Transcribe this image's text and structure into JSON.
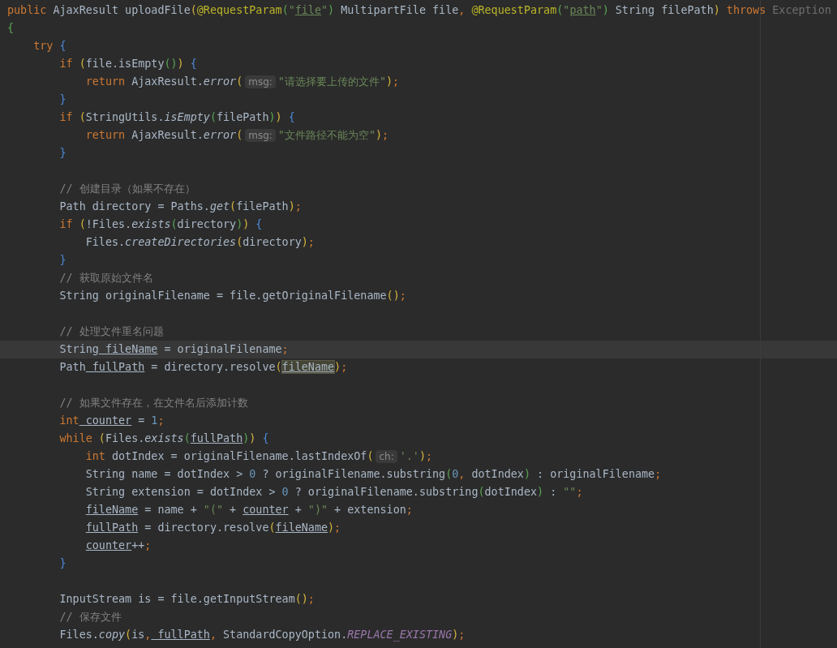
{
  "editor": {
    "lines": [
      {
        "kind": "code",
        "current": false,
        "tokens": [
          {
            "kind": "kw",
            "text": "public"
          },
          {
            "kind": "text",
            "text": " AjaxResult uploadFile"
          },
          {
            "kind": "br1",
            "text": "("
          },
          {
            "kind": "ann",
            "text": "@RequestParam"
          },
          {
            "kind": "br2",
            "text": "("
          },
          {
            "kind": "str",
            "text": "\""
          },
          {
            "kind": "strvar",
            "text": "file"
          },
          {
            "kind": "str",
            "text": "\""
          },
          {
            "kind": "br2",
            "text": ")"
          },
          {
            "kind": "text",
            "text": " MultipartFile file"
          },
          {
            "kind": "punct",
            "text": ","
          },
          {
            "kind": "ann",
            "text": " @RequestParam"
          },
          {
            "kind": "br2",
            "text": "("
          },
          {
            "kind": "str",
            "text": "\""
          },
          {
            "kind": "strvar",
            "text": "path"
          },
          {
            "kind": "str",
            "text": "\""
          },
          {
            "kind": "br2",
            "text": ")"
          },
          {
            "kind": "text",
            "text": " String filePath"
          },
          {
            "kind": "br1",
            "text": ")"
          },
          {
            "kind": "kw",
            "text": " throws"
          },
          {
            "kind": "dim",
            "text": " Exception"
          }
        ]
      },
      {
        "kind": "code",
        "current": false,
        "tokens": [
          {
            "kind": "br2",
            "text": "{"
          }
        ],
        "children": [
          {
            "kind": "code",
            "current": false,
            "tokens": [
              {
                "kind": "kw",
                "text": "try"
              },
              {
                "kind": "br3",
                "text": " {"
              }
            ],
            "children": [
              {
                "kind": "code",
                "current": false,
                "tokens": [
                  {
                    "kind": "kw",
                    "text": "if"
                  },
                  {
                    "kind": "br1",
                    "text": " ("
                  },
                  {
                    "kind": "text",
                    "text": "file.isEmpty"
                  },
                  {
                    "kind": "br2",
                    "text": "()"
                  },
                  {
                    "kind": "br1",
                    "text": ")"
                  },
                  {
                    "kind": "br3",
                    "text": " {"
                  }
                ],
                "children": [
                  {
                    "kind": "code",
                    "current": false,
                    "tokens": [
                      {
                        "kind": "kw",
                        "text": "return"
                      },
                      {
                        "kind": "text",
                        "text": " AjaxResult."
                      },
                      {
                        "kind": "italic",
                        "text": "error"
                      },
                      {
                        "kind": "br1",
                        "text": "("
                      },
                      {
                        "kind": "hint",
                        "text": "msg:"
                      },
                      {
                        "kind": "str",
                        "text": "\"请选择要上传的文件\""
                      },
                      {
                        "kind": "br1",
                        "text": ")"
                      },
                      {
                        "kind": "punct",
                        "text": ";"
                      }
                    ]
                  }
                ]
              },
              {
                "kind": "code",
                "current": false,
                "tokens": [
                  {
                    "kind": "br3",
                    "text": "}"
                  }
                ]
              },
              {
                "kind": "code",
                "current": false,
                "tokens": [
                  {
                    "kind": "kw",
                    "text": "if"
                  },
                  {
                    "kind": "br1",
                    "text": " ("
                  },
                  {
                    "kind": "text",
                    "text": "StringUtils."
                  },
                  {
                    "kind": "italic",
                    "text": "isEmpty"
                  },
                  {
                    "kind": "br2",
                    "text": "("
                  },
                  {
                    "kind": "text",
                    "text": "filePath"
                  },
                  {
                    "kind": "br2",
                    "text": ")"
                  },
                  {
                    "kind": "br1",
                    "text": ")"
                  },
                  {
                    "kind": "br3",
                    "text": " {"
                  }
                ],
                "children": [
                  {
                    "kind": "code",
                    "current": false,
                    "tokens": [
                      {
                        "kind": "kw",
                        "text": "return"
                      },
                      {
                        "kind": "text",
                        "text": " AjaxResult."
                      },
                      {
                        "kind": "italic",
                        "text": "error"
                      },
                      {
                        "kind": "br1",
                        "text": "("
                      },
                      {
                        "kind": "hint",
                        "text": "msg:"
                      },
                      {
                        "kind": "str",
                        "text": "\"文件路径不能为空\""
                      },
                      {
                        "kind": "br1",
                        "text": ")"
                      },
                      {
                        "kind": "punct",
                        "text": ";"
                      }
                    ]
                  }
                ]
              },
              {
                "kind": "code",
                "current": false,
                "tokens": [
                  {
                    "kind": "br3",
                    "text": "}"
                  }
                ]
              },
              {
                "kind": "blank",
                "current": false
              },
              {
                "kind": "code",
                "current": false,
                "tokens": [
                  {
                    "kind": "comment",
                    "text": "// 创建目录（如果不存在）"
                  }
                ]
              },
              {
                "kind": "code",
                "current": false,
                "tokens": [
                  {
                    "kind": "text",
                    "text": "Path directory = Paths."
                  },
                  {
                    "kind": "italic",
                    "text": "get"
                  },
                  {
                    "kind": "br1",
                    "text": "("
                  },
                  {
                    "kind": "text",
                    "text": "filePath"
                  },
                  {
                    "kind": "br1",
                    "text": ")"
                  },
                  {
                    "kind": "punct",
                    "text": ";"
                  }
                ]
              },
              {
                "kind": "code",
                "current": false,
                "tokens": [
                  {
                    "kind": "kw",
                    "text": "if"
                  },
                  {
                    "kind": "br1",
                    "text": " ("
                  },
                  {
                    "kind": "text",
                    "text": "!Files."
                  },
                  {
                    "kind": "italic",
                    "text": "exists"
                  },
                  {
                    "kind": "br2",
                    "text": "("
                  },
                  {
                    "kind": "text",
                    "text": "directory"
                  },
                  {
                    "kind": "br2",
                    "text": ")"
                  },
                  {
                    "kind": "br1",
                    "text": ")"
                  },
                  {
                    "kind": "br3",
                    "text": " {"
                  }
                ],
                "children": [
                  {
                    "kind": "code",
                    "current": false,
                    "tokens": [
                      {
                        "kind": "text",
                        "text": "Files."
                      },
                      {
                        "kind": "italic",
                        "text": "createDirectories"
                      },
                      {
                        "kind": "br1",
                        "text": "("
                      },
                      {
                        "kind": "text",
                        "text": "directory"
                      },
                      {
                        "kind": "br1",
                        "text": ")"
                      },
                      {
                        "kind": "punct",
                        "text": ";"
                      }
                    ]
                  }
                ]
              },
              {
                "kind": "code",
                "current": false,
                "tokens": [
                  {
                    "kind": "br3",
                    "text": "}"
                  }
                ]
              },
              {
                "kind": "code",
                "current": false,
                "tokens": [
                  {
                    "kind": "comment",
                    "text": "// 获取原始文件名"
                  }
                ]
              },
              {
                "kind": "code",
                "current": false,
                "tokens": [
                  {
                    "kind": "text",
                    "text": "String originalFilename = file.getOriginalFilename"
                  },
                  {
                    "kind": "br1",
                    "text": "()"
                  },
                  {
                    "kind": "punct",
                    "text": ";"
                  }
                ]
              },
              {
                "kind": "blank",
                "current": false
              },
              {
                "kind": "code",
                "current": false,
                "tokens": [
                  {
                    "kind": "comment",
                    "text": "// 处理文件重名问题"
                  }
                ]
              },
              {
                "kind": "code",
                "current": true,
                "tokens": [
                  {
                    "kind": "text",
                    "text": "String"
                  },
                  {
                    "kind": "var",
                    "text": " fileName"
                  },
                  {
                    "kind": "text",
                    "text": " = originalFilename"
                  },
                  {
                    "kind": "punct",
                    "text": ";"
                  }
                ]
              },
              {
                "kind": "code",
                "current": false,
                "tokens": [
                  {
                    "kind": "text",
                    "text": "Path"
                  },
                  {
                    "kind": "var",
                    "text": " fullPath"
                  },
                  {
                    "kind": "text",
                    "text": " = directory.resolve"
                  },
                  {
                    "kind": "br1",
                    "text": "("
                  },
                  {
                    "kind": "hl",
                    "text": "fileName"
                  },
                  {
                    "kind": "br1",
                    "text": ")"
                  },
                  {
                    "kind": "punct",
                    "text": ";"
                  }
                ]
              },
              {
                "kind": "blank",
                "current": false
              },
              {
                "kind": "code",
                "current": false,
                "tokens": [
                  {
                    "kind": "comment",
                    "text": "// 如果文件存在，在文件名后添加计数"
                  }
                ]
              },
              {
                "kind": "code",
                "current": false,
                "tokens": [
                  {
                    "kind": "kw",
                    "text": "int"
                  },
                  {
                    "kind": "var",
                    "text": " counter"
                  },
                  {
                    "kind": "text",
                    "text": " = "
                  },
                  {
                    "kind": "num",
                    "text": "1"
                  },
                  {
                    "kind": "punct",
                    "text": ";"
                  }
                ]
              },
              {
                "kind": "code",
                "current": false,
                "tokens": [
                  {
                    "kind": "kw",
                    "text": "while"
                  },
                  {
                    "kind": "br1",
                    "text": " ("
                  },
                  {
                    "kind": "text",
                    "text": "Files."
                  },
                  {
                    "kind": "italic",
                    "text": "exists"
                  },
                  {
                    "kind": "br2",
                    "text": "("
                  },
                  {
                    "kind": "var",
                    "text": "fullPath"
                  },
                  {
                    "kind": "br2",
                    "text": ")"
                  },
                  {
                    "kind": "br1",
                    "text": ")"
                  },
                  {
                    "kind": "br3",
                    "text": " {"
                  }
                ],
                "children": [
                  {
                    "kind": "code",
                    "current": false,
                    "tokens": [
                      {
                        "kind": "kw",
                        "text": "int"
                      },
                      {
                        "kind": "text",
                        "text": " dotIndex = originalFilename.lastIndexOf"
                      },
                      {
                        "kind": "br1",
                        "text": "("
                      },
                      {
                        "kind": "hint",
                        "text": "ch:"
                      },
                      {
                        "kind": "str",
                        "text": "'.'"
                      },
                      {
                        "kind": "br1",
                        "text": ")"
                      },
                      {
                        "kind": "punct",
                        "text": ";"
                      }
                    ]
                  },
                  {
                    "kind": "code",
                    "current": false,
                    "tokens": [
                      {
                        "kind": "text",
                        "text": "String name = dotIndex > "
                      },
                      {
                        "kind": "num",
                        "text": "0"
                      },
                      {
                        "kind": "text",
                        "text": " ? originalFilename.substring"
                      },
                      {
                        "kind": "br2",
                        "text": "("
                      },
                      {
                        "kind": "num",
                        "text": "0"
                      },
                      {
                        "kind": "punct",
                        "text": ","
                      },
                      {
                        "kind": "text",
                        "text": " dotIndex"
                      },
                      {
                        "kind": "br2",
                        "text": ")"
                      },
                      {
                        "kind": "text",
                        "text": " : originalFilename"
                      },
                      {
                        "kind": "punct",
                        "text": ";"
                      }
                    ]
                  },
                  {
                    "kind": "code",
                    "current": false,
                    "tokens": [
                      {
                        "kind": "text",
                        "text": "String extension = dotIndex > "
                      },
                      {
                        "kind": "num",
                        "text": "0"
                      },
                      {
                        "kind": "text",
                        "text": " ? originalFilename.substring"
                      },
                      {
                        "kind": "br2",
                        "text": "("
                      },
                      {
                        "kind": "text",
                        "text": "dotIndex"
                      },
                      {
                        "kind": "br2",
                        "text": ")"
                      },
                      {
                        "kind": "text",
                        "text": " : "
                      },
                      {
                        "kind": "str",
                        "text": "\"\""
                      },
                      {
                        "kind": "punct",
                        "text": ";"
                      }
                    ]
                  },
                  {
                    "kind": "code",
                    "current": false,
                    "tokens": [
                      {
                        "kind": "var",
                        "text": "fileName"
                      },
                      {
                        "kind": "text",
                        "text": " = name + "
                      },
                      {
                        "kind": "str",
                        "text": "\"(\""
                      },
                      {
                        "kind": "text",
                        "text": " + "
                      },
                      {
                        "kind": "var",
                        "text": "counter"
                      },
                      {
                        "kind": "text",
                        "text": " + "
                      },
                      {
                        "kind": "str",
                        "text": "\")\""
                      },
                      {
                        "kind": "text",
                        "text": " + extension"
                      },
                      {
                        "kind": "punct",
                        "text": ";"
                      }
                    ]
                  },
                  {
                    "kind": "code",
                    "current": false,
                    "tokens": [
                      {
                        "kind": "var",
                        "text": "fullPath"
                      },
                      {
                        "kind": "text",
                        "text": " = directory.resolve"
                      },
                      {
                        "kind": "br1",
                        "text": "("
                      },
                      {
                        "kind": "var",
                        "text": "fileName"
                      },
                      {
                        "kind": "br1",
                        "text": ")"
                      },
                      {
                        "kind": "punct",
                        "text": ";"
                      }
                    ]
                  },
                  {
                    "kind": "code",
                    "current": false,
                    "tokens": [
                      {
                        "kind": "var",
                        "text": "counter"
                      },
                      {
                        "kind": "text",
                        "text": "++"
                      },
                      {
                        "kind": "punct",
                        "text": ";"
                      }
                    ]
                  }
                ]
              },
              {
                "kind": "code",
                "current": false,
                "tokens": [
                  {
                    "kind": "br3",
                    "text": "}"
                  }
                ]
              },
              {
                "kind": "blank",
                "current": false
              },
              {
                "kind": "code",
                "current": false,
                "tokens": [
                  {
                    "kind": "text",
                    "text": "InputStream is = file.getInputStream"
                  },
                  {
                    "kind": "br1",
                    "text": "()"
                  },
                  {
                    "kind": "punct",
                    "text": ";"
                  }
                ]
              },
              {
                "kind": "code",
                "current": false,
                "tokens": [
                  {
                    "kind": "comment",
                    "text": "// 保存文件"
                  }
                ]
              },
              {
                "kind": "code",
                "current": false,
                "tokens": [
                  {
                    "kind": "text",
                    "text": "Files."
                  },
                  {
                    "kind": "italic",
                    "text": "copy"
                  },
                  {
                    "kind": "br1",
                    "text": "("
                  },
                  {
                    "kind": "text",
                    "text": "is"
                  },
                  {
                    "kind": "punct",
                    "text": ","
                  },
                  {
                    "kind": "var",
                    "text": " fullPath"
                  },
                  {
                    "kind": "punct",
                    "text": ","
                  },
                  {
                    "kind": "text",
                    "text": " StandardCopyOption."
                  },
                  {
                    "kind": "const",
                    "text": "REPLACE_EXISTING"
                  },
                  {
                    "kind": "br1",
                    "text": ")"
                  },
                  {
                    "kind": "punct",
                    "text": ";"
                  }
                ]
              }
            ]
          }
        ]
      }
    ]
  }
}
